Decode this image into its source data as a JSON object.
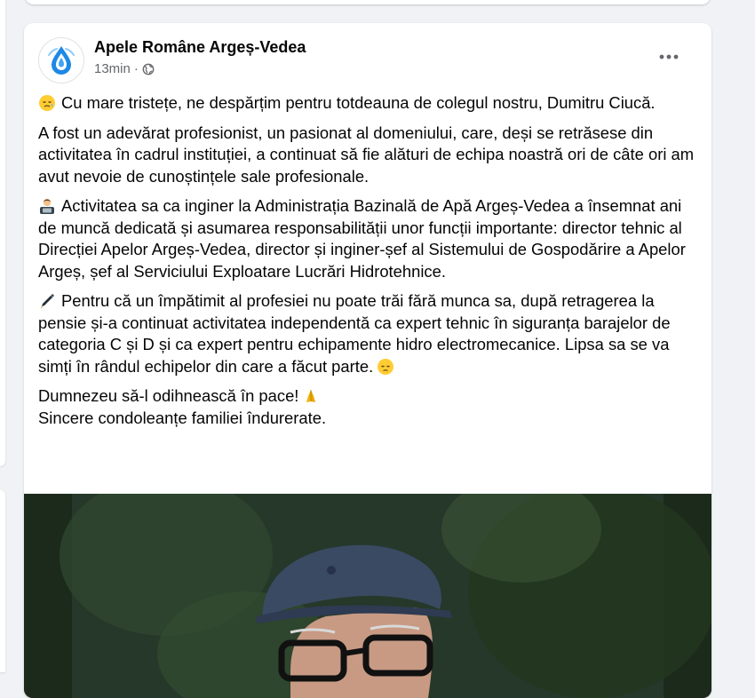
{
  "post": {
    "page_name": "Apele Române Argeș-Vedea",
    "time": "13min",
    "separator": "·",
    "icons": {
      "avatar": "water-drop-logo-icon",
      "privacy": "globe-icon",
      "more": "more-horizontal-icon"
    },
    "paragraphs": {
      "p1": "Cu mare tristețe, ne despărțim pentru totdeauna de colegul nostru, Dumitru Ciucă.",
      "p2": "A fost un adevărat profesionist, un pasionat al domeniului, care, deși se retrăsese din activitatea în cadrul instituției, a continuat să fie alături de echipa noastră ori de câte ori am avut nevoie de cunoștințele sale profesionale.",
      "p3": "Activitatea sa ca inginer la Administrația Bazinală de Apă Argeș-Vedea a însemnat ani de muncă dedicată și asumarea responsabilității unor funcții importante: director tehnic al Direcției Apelor Argeș-Vedea, director și inginer-șef al Sistemului de Gospodărire a Apelor Argeș, șef al Serviciului Exploatare Lucrări Hidrotehnice.",
      "p4": "Pentru că un împătimit al profesiei nu poate trăi fără munca sa, după retragerea la pensie și-a continuat activitatea independentă ca expert tehnic în siguranța barajelor de categoria C și D și ca expert pentru echipamente hidro electromecanice. Lipsa sa se va simți în rândul echipelor din care a făcut parte.",
      "p5_line1": "Dumnezeu să-l odihnească în pace!",
      "p5_line2": "Sincere condoleanțe familiei îndurerate."
    },
    "emoji": {
      "p1": "sad-relieved-face-emoji",
      "p3": "man-technologist-emoji",
      "p4": "pen-emoji",
      "p4_end": "pensive-face-emoji",
      "p5_end": "folded-hands-emoji"
    }
  }
}
